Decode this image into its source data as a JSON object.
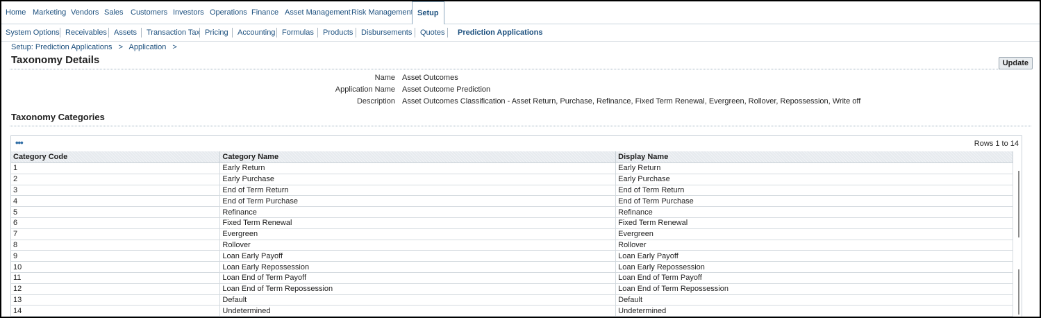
{
  "top_tabs": [
    "Home",
    "Marketing",
    "Vendors",
    "Sales",
    "Customers",
    "Investors",
    "Operations",
    "Finance",
    "Asset Management",
    "Risk Management",
    "Setup"
  ],
  "active_top_tab": "Setup",
  "sub_tabs": [
    "System Options",
    "Receivables",
    "Assets",
    "Transaction Tax",
    "Pricing",
    "Accounting",
    "Formulas",
    "Products",
    "Disbursements",
    "Quotes",
    "Prediction Applications"
  ],
  "active_sub_tab": "Prediction Applications",
  "breadcrumb": [
    "Setup: Prediction Applications",
    ">",
    "Application",
    ">"
  ],
  "page_title": "Taxonomy Details",
  "update_label": "Update",
  "details": [
    {
      "label": "Name",
      "value": "Asset Outcomes"
    },
    {
      "label": "Application Name",
      "value": "Asset Outcome Prediction"
    },
    {
      "label": "Description",
      "value": "Asset Outcomes Classification - Asset Return, Purchase, Refinance, Fixed Term Renewal, Evergreen, Rollover, Repossession, Write off"
    }
  ],
  "section_title": "Taxonomy Categories",
  "table": {
    "dots": "•••",
    "rows_info": "Rows 1 to 14",
    "columns": [
      "Category Code",
      "Category Name",
      "Display Name"
    ],
    "rows": [
      [
        "1",
        "Early Return",
        "Early Return"
      ],
      [
        "2",
        "Early Purchase",
        "Early Purchase"
      ],
      [
        "3",
        "End of Term Return",
        "End of Term Return"
      ],
      [
        "4",
        "End of Term Purchase",
        "End of Term Purchase"
      ],
      [
        "5",
        "Refinance",
        "Refinance"
      ],
      [
        "6",
        "Fixed Term Renewal",
        "Fixed Term Renewal"
      ],
      [
        "7",
        "Evergreen",
        "Evergreen"
      ],
      [
        "8",
        "Rollover",
        "Rollover"
      ],
      [
        "9",
        "Loan Early Payoff",
        "Loan Early Payoff"
      ],
      [
        "10",
        "Loan Early Repossession",
        "Loan Early Repossession"
      ],
      [
        "11",
        "Loan End of Term Payoff",
        "Loan End of Term Payoff"
      ],
      [
        "12",
        "Loan End of Term Repossession",
        "Loan End of Term Repossession"
      ],
      [
        "13",
        "Default",
        "Default"
      ],
      [
        "14",
        "Undetermined",
        "Undetermined"
      ]
    ]
  }
}
